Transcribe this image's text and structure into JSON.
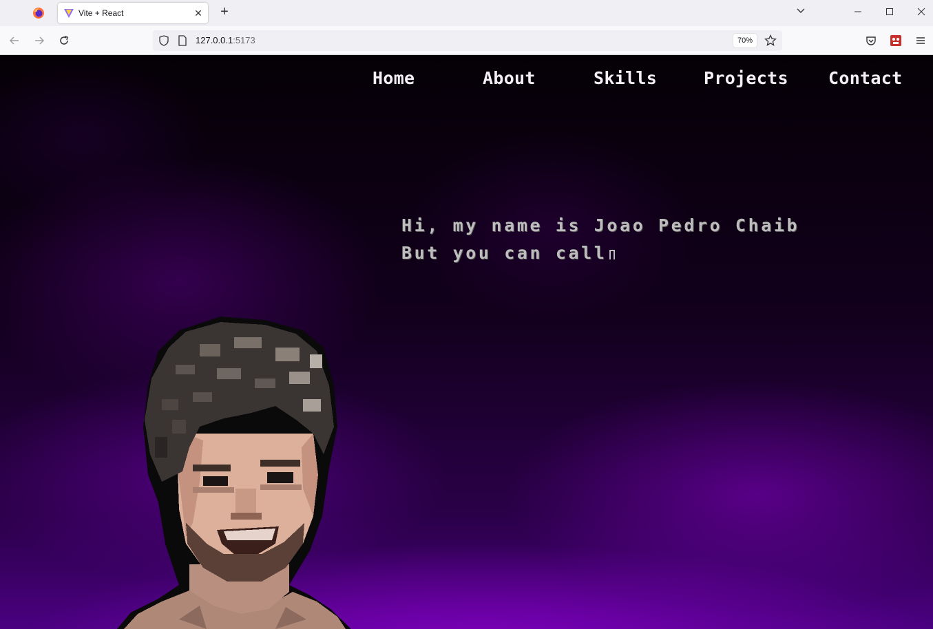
{
  "browser": {
    "tab_title": "Vite + React",
    "url_host": "127.0.0.1",
    "url_port": ":5173",
    "zoom": "70%",
    "new_tab_icon": "+",
    "tab_close_icon": "✕"
  },
  "nav": {
    "items": [
      {
        "label": "Home"
      },
      {
        "label": "About"
      },
      {
        "label": "Skills"
      },
      {
        "label": "Projects"
      },
      {
        "label": "Contact"
      }
    ]
  },
  "hero": {
    "line1": "Hi, my name is Joao Pedro Chaib",
    "line2": "But you can call"
  },
  "colors": {
    "background_top": "#050006",
    "background_bottom": "#4a0080",
    "nav_text": "#f2f0f4",
    "intro_text": "#bdbdbd"
  }
}
